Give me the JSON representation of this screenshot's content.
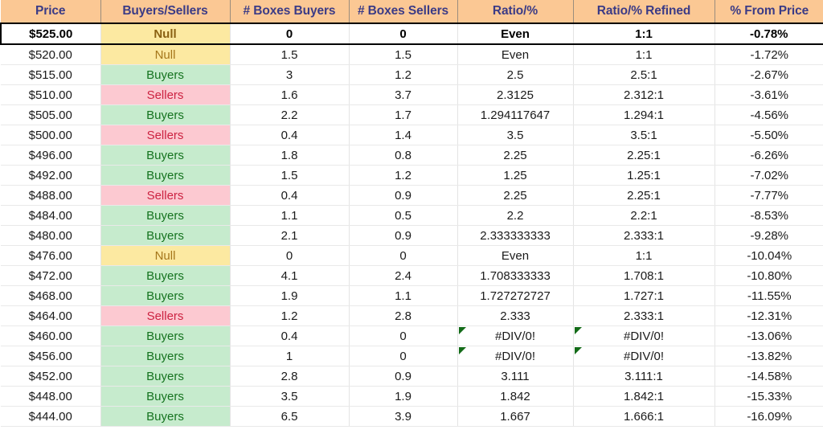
{
  "table": {
    "columns": [
      {
        "key": "price",
        "label": "Price"
      },
      {
        "key": "signal",
        "label": "Buyers/Sellers"
      },
      {
        "key": "boxes_buy",
        "label": "# Boxes Buyers"
      },
      {
        "key": "boxes_sell",
        "label": "# Boxes Sellers"
      },
      {
        "key": "ratio",
        "label": "Ratio/%"
      },
      {
        "key": "ratio_ref",
        "label": "Ratio/% Refined"
      },
      {
        "key": "pct_from",
        "label": "% From Price"
      }
    ],
    "colors": {
      "header_bg": "#fbc894",
      "header_text": "#3b3b86",
      "buyers_bg": "#c6ebcd",
      "buyers_text": "#15731f",
      "sellers_bg": "#fcc9d1",
      "sellers_text": "#cc2241",
      "null_bg": "#fce9a1",
      "null_text": "#a5761a",
      "error_flag": "#136b18",
      "highlight_border": "#000000"
    },
    "rows": [
      {
        "price": "$525.00",
        "signal": "Null",
        "signal_type": "null",
        "boxes_buy": "0",
        "boxes_sell": "0",
        "ratio": "Even",
        "ratio_ref": "1:1",
        "pct_from": "-0.78%",
        "highlight": true,
        "error": false
      },
      {
        "price": "$520.00",
        "signal": "Null",
        "signal_type": "null",
        "boxes_buy": "1.5",
        "boxes_sell": "1.5",
        "ratio": "Even",
        "ratio_ref": "1:1",
        "pct_from": "-1.72%",
        "highlight": false,
        "error": false
      },
      {
        "price": "$515.00",
        "signal": "Buyers",
        "signal_type": "buyers",
        "boxes_buy": "3",
        "boxes_sell": "1.2",
        "ratio": "2.5",
        "ratio_ref": "2.5:1",
        "pct_from": "-2.67%",
        "highlight": false,
        "error": false
      },
      {
        "price": "$510.00",
        "signal": "Sellers",
        "signal_type": "sellers",
        "boxes_buy": "1.6",
        "boxes_sell": "3.7",
        "ratio": "2.3125",
        "ratio_ref": "2.312:1",
        "pct_from": "-3.61%",
        "highlight": false,
        "error": false
      },
      {
        "price": "$505.00",
        "signal": "Buyers",
        "signal_type": "buyers",
        "boxes_buy": "2.2",
        "boxes_sell": "1.7",
        "ratio": "1.294117647",
        "ratio_ref": "1.294:1",
        "pct_from": "-4.56%",
        "highlight": false,
        "error": false
      },
      {
        "price": "$500.00",
        "signal": "Sellers",
        "signal_type": "sellers",
        "boxes_buy": "0.4",
        "boxes_sell": "1.4",
        "ratio": "3.5",
        "ratio_ref": "3.5:1",
        "pct_from": "-5.50%",
        "highlight": false,
        "error": false
      },
      {
        "price": "$496.00",
        "signal": "Buyers",
        "signal_type": "buyers",
        "boxes_buy": "1.8",
        "boxes_sell": "0.8",
        "ratio": "2.25",
        "ratio_ref": "2.25:1",
        "pct_from": "-6.26%",
        "highlight": false,
        "error": false
      },
      {
        "price": "$492.00",
        "signal": "Buyers",
        "signal_type": "buyers",
        "boxes_buy": "1.5",
        "boxes_sell": "1.2",
        "ratio": "1.25",
        "ratio_ref": "1.25:1",
        "pct_from": "-7.02%",
        "highlight": false,
        "error": false
      },
      {
        "price": "$488.00",
        "signal": "Sellers",
        "signal_type": "sellers",
        "boxes_buy": "0.4",
        "boxes_sell": "0.9",
        "ratio": "2.25",
        "ratio_ref": "2.25:1",
        "pct_from": "-7.77%",
        "highlight": false,
        "error": false
      },
      {
        "price": "$484.00",
        "signal": "Buyers",
        "signal_type": "buyers",
        "boxes_buy": "1.1",
        "boxes_sell": "0.5",
        "ratio": "2.2",
        "ratio_ref": "2.2:1",
        "pct_from": "-8.53%",
        "highlight": false,
        "error": false
      },
      {
        "price": "$480.00",
        "signal": "Buyers",
        "signal_type": "buyers",
        "boxes_buy": "2.1",
        "boxes_sell": "0.9",
        "ratio": "2.333333333",
        "ratio_ref": "2.333:1",
        "pct_from": "-9.28%",
        "highlight": false,
        "error": false
      },
      {
        "price": "$476.00",
        "signal": "Null",
        "signal_type": "null",
        "boxes_buy": "0",
        "boxes_sell": "0",
        "ratio": "Even",
        "ratio_ref": "1:1",
        "pct_from": "-10.04%",
        "highlight": false,
        "error": false
      },
      {
        "price": "$472.00",
        "signal": "Buyers",
        "signal_type": "buyers",
        "boxes_buy": "4.1",
        "boxes_sell": "2.4",
        "ratio": "1.708333333",
        "ratio_ref": "1.708:1",
        "pct_from": "-10.80%",
        "highlight": false,
        "error": false
      },
      {
        "price": "$468.00",
        "signal": "Buyers",
        "signal_type": "buyers",
        "boxes_buy": "1.9",
        "boxes_sell": "1.1",
        "ratio": "1.727272727",
        "ratio_ref": "1.727:1",
        "pct_from": "-11.55%",
        "highlight": false,
        "error": false
      },
      {
        "price": "$464.00",
        "signal": "Sellers",
        "signal_type": "sellers",
        "boxes_buy": "1.2",
        "boxes_sell": "2.8",
        "ratio": "2.333",
        "ratio_ref": "2.333:1",
        "pct_from": "-12.31%",
        "highlight": false,
        "error": false
      },
      {
        "price": "$460.00",
        "signal": "Buyers",
        "signal_type": "buyers",
        "boxes_buy": "0.4",
        "boxes_sell": "0",
        "ratio": "#DIV/0!",
        "ratio_ref": "#DIV/0!",
        "pct_from": "-13.06%",
        "highlight": false,
        "error": true
      },
      {
        "price": "$456.00",
        "signal": "Buyers",
        "signal_type": "buyers",
        "boxes_buy": "1",
        "boxes_sell": "0",
        "ratio": "#DIV/0!",
        "ratio_ref": "#DIV/0!",
        "pct_from": "-13.82%",
        "highlight": false,
        "error": true
      },
      {
        "price": "$452.00",
        "signal": "Buyers",
        "signal_type": "buyers",
        "boxes_buy": "2.8",
        "boxes_sell": "0.9",
        "ratio": "3.111",
        "ratio_ref": "3.111:1",
        "pct_from": "-14.58%",
        "highlight": false,
        "error": false
      },
      {
        "price": "$448.00",
        "signal": "Buyers",
        "signal_type": "buyers",
        "boxes_buy": "3.5",
        "boxes_sell": "1.9",
        "ratio": "1.842",
        "ratio_ref": "1.842:1",
        "pct_from": "-15.33%",
        "highlight": false,
        "error": false
      },
      {
        "price": "$444.00",
        "signal": "Buyers",
        "signal_type": "buyers",
        "boxes_buy": "6.5",
        "boxes_sell": "3.9",
        "ratio": "1.667",
        "ratio_ref": "1.666:1",
        "pct_from": "-16.09%",
        "highlight": false,
        "error": false
      }
    ]
  }
}
